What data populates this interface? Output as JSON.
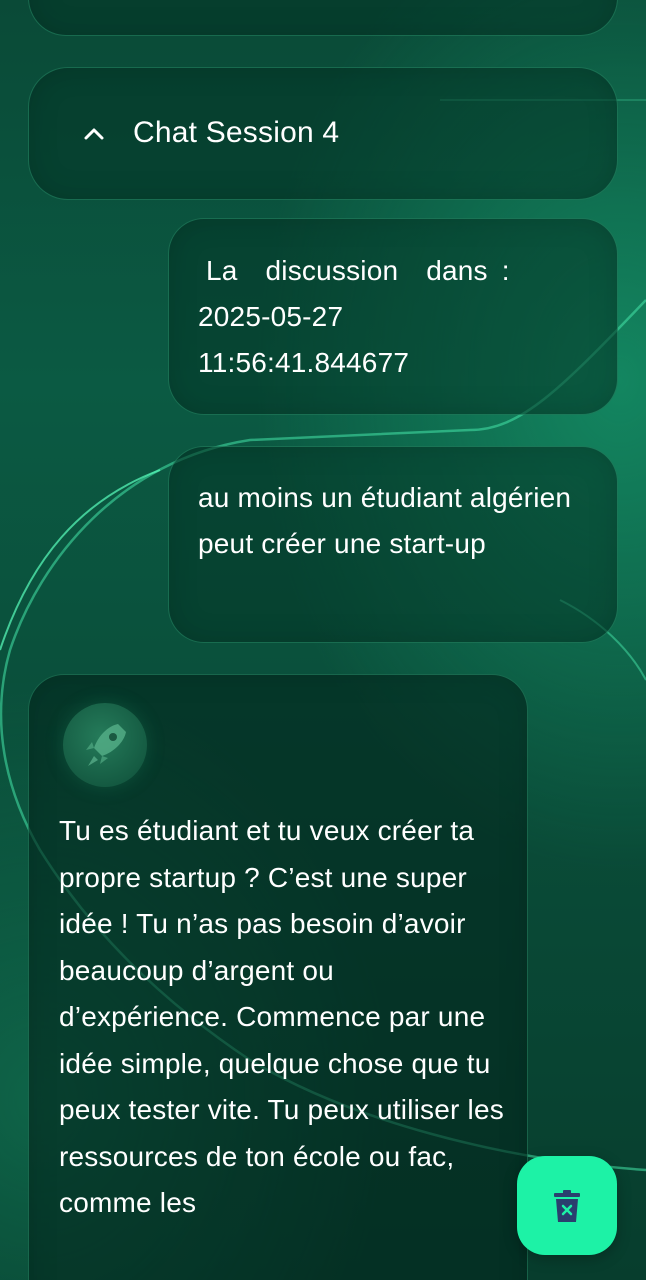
{
  "session": {
    "title": "Chat Session 4"
  },
  "messages": [
    {
      "role": "user",
      "lines": [
        "La  discussion  dans :",
        "2025-05-27",
        "11:56:41.844677"
      ]
    },
    {
      "role": "user",
      "text": "au moins un étudiant algérien peut créer une start-up"
    },
    {
      "role": "assistant",
      "text": "Tu es étudiant et tu veux créer ta propre startup ? C’est une super idée ! Tu n’as pas besoin d’avoir beaucoup d’argent ou d’expérience. Commence par une idée simple, quelque chose que tu peux tester vite. Tu peux utiliser les ressources de ton école ou fac, comme les"
    }
  ],
  "icons": {
    "collapse": "chevron-up-icon",
    "avatar": "rocket-icon",
    "delete": "trash-icon"
  },
  "colors": {
    "fab_background": "#1df2a6",
    "fab_icon": "#2a3f6e",
    "text": "#ffffff"
  }
}
